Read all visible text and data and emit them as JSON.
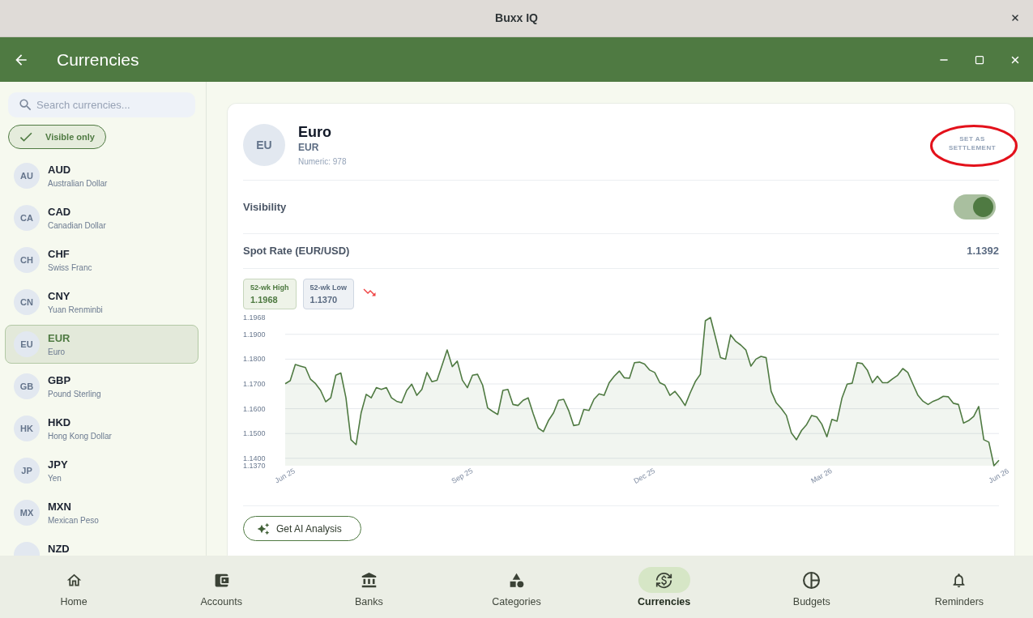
{
  "window": {
    "title": "Buxx IQ"
  },
  "app_bar": {
    "title": "Currencies"
  },
  "sidebar": {
    "search": {
      "placeholder": "Search currencies..."
    },
    "filter_chip": {
      "label": "Visible only",
      "checked": true
    },
    "currencies": [
      {
        "initials": "AU",
        "code": "AUD",
        "name": "Australian Dollar",
        "selected": false
      },
      {
        "initials": "CA",
        "code": "CAD",
        "name": "Canadian Dollar",
        "selected": false
      },
      {
        "initials": "CH",
        "code": "CHF",
        "name": "Swiss Franc",
        "selected": false
      },
      {
        "initials": "CN",
        "code": "CNY",
        "name": "Yuan Renminbi",
        "selected": false
      },
      {
        "initials": "EU",
        "code": "EUR",
        "name": "Euro",
        "selected": true
      },
      {
        "initials": "GB",
        "code": "GBP",
        "name": "Pound Sterling",
        "selected": false
      },
      {
        "initials": "HK",
        "code": "HKD",
        "name": "Hong Kong Dollar",
        "selected": false
      },
      {
        "initials": "JP",
        "code": "JPY",
        "name": "Yen",
        "selected": false
      },
      {
        "initials": "MX",
        "code": "MXN",
        "name": "Mexican Peso",
        "selected": false
      },
      {
        "code": "NZD",
        "selected": false
      }
    ]
  },
  "detail": {
    "initials": "EU",
    "name": "Euro",
    "code": "EUR",
    "numeric": "Numeric: 978",
    "settlement_button": {
      "label": "SET AS SETTLEMENT",
      "highlighted": true
    },
    "visibility": {
      "label": "Visibility",
      "on": true
    },
    "spot_rate": {
      "label": "Spot Rate (EUR/USD)",
      "value": "1.1392"
    },
    "stats": [
      {
        "kind": "high",
        "label": "52-wk High",
        "value": "1.1968"
      },
      {
        "kind": "low",
        "label": "52-wk Low",
        "value": "1.1370"
      }
    ],
    "trend": {
      "kind": "down"
    },
    "chart_data": {
      "type": "area",
      "grid": true,
      "ylim": [
        1.137,
        1.1968
      ],
      "yticks": [
        {
          "value": 1.137,
          "label": "1.1370"
        },
        {
          "value": 1.14,
          "label": "1.1400"
        },
        {
          "value": 1.15,
          "label": "1.1500"
        },
        {
          "value": 1.16,
          "label": "1.1600"
        },
        {
          "value": 1.17,
          "label": "1.1700"
        },
        {
          "value": 1.18,
          "label": "1.1800"
        },
        {
          "value": 1.19,
          "label": "1.1900"
        },
        {
          "value": 1.1968,
          "label": "1.1968"
        }
      ],
      "categories": [
        "Jun 25",
        null,
        null,
        null,
        null,
        null,
        null,
        null,
        null,
        null,
        null,
        null,
        null,
        null,
        null,
        null,
        null,
        null,
        null,
        null,
        null,
        null,
        null,
        null,
        null,
        null,
        null,
        null,
        null,
        null,
        null,
        null,
        null,
        null,
        null,
        "Sep 25",
        null,
        null,
        null,
        null,
        null,
        null,
        null,
        null,
        null,
        null,
        null,
        null,
        null,
        null,
        null,
        null,
        null,
        null,
        null,
        null,
        null,
        null,
        null,
        null,
        null,
        null,
        null,
        null,
        null,
        null,
        null,
        null,
        null,
        null,
        null,
        "Dec 25",
        null,
        null,
        null,
        null,
        null,
        null,
        null,
        null,
        null,
        null,
        null,
        null,
        null,
        null,
        null,
        null,
        null,
        null,
        null,
        null,
        null,
        null,
        null,
        null,
        null,
        null,
        null,
        null,
        null,
        null,
        null,
        null,
        null,
        null,
        "Mar 26",
        null,
        null,
        null,
        null,
        null,
        null,
        null,
        null,
        null,
        null,
        null,
        null,
        null,
        null,
        null,
        null,
        null,
        null,
        null,
        null,
        null,
        null,
        null,
        null,
        null,
        null,
        null,
        null,
        null,
        null,
        null,
        null,
        null,
        null,
        "Jun 26"
      ],
      "series": [
        {
          "color": "#4f7a42",
          "values": [
            1.1701,
            1.1713,
            1.1778,
            1.1772,
            1.1766,
            1.1719,
            1.1701,
            1.1674,
            1.1628,
            1.1644,
            1.1735,
            1.1744,
            1.1644,
            1.1475,
            1.1455,
            1.1583,
            1.1658,
            1.1644,
            1.1685,
            1.1678,
            1.1685,
            1.1644,
            1.163,
            1.1624,
            1.1674,
            1.1699,
            1.1654,
            1.1678,
            1.1746,
            1.1709,
            1.1715,
            1.1776,
            1.1837,
            1.177,
            1.1792,
            1.1715,
            1.1685,
            1.1735,
            1.1739,
            1.1695,
            1.1603,
            1.1589,
            1.1577,
            1.1674,
            1.1678,
            1.1617,
            1.1613,
            1.1634,
            1.1644,
            1.1579,
            1.1522,
            1.1508,
            1.1552,
            1.1583,
            1.1634,
            1.1638,
            1.1593,
            1.1532,
            1.1536,
            1.1597,
            1.1593,
            1.1638,
            1.166,
            1.1654,
            1.1705,
            1.1731,
            1.1752,
            1.1725,
            1.1723,
            1.1786,
            1.1788,
            1.178,
            1.1756,
            1.1746,
            1.1705,
            1.1695,
            1.1654,
            1.167,
            1.1644,
            1.1613,
            1.1664,
            1.1709,
            1.1739,
            1.1955,
            1.1968,
            1.1888,
            1.1806,
            1.18,
            1.1898,
            1.1872,
            1.1857,
            1.1837,
            1.1772,
            1.18,
            1.1811,
            1.1806,
            1.167,
            1.1624,
            1.1601,
            1.1573,
            1.1502,
            1.1475,
            1.1512,
            1.1536,
            1.1573,
            1.1567,
            1.1538,
            1.1487,
            1.1557,
            1.155,
            1.1644,
            1.1699,
            1.1703,
            1.1786,
            1.1782,
            1.1756,
            1.1705,
            1.1731,
            1.1705,
            1.1705,
            1.1721,
            1.1735,
            1.1762,
            1.1746,
            1.1699,
            1.1654,
            1.163,
            1.1617,
            1.163,
            1.1638,
            1.165,
            1.1648,
            1.1622,
            1.1617,
            1.1542,
            1.1552,
            1.1569,
            1.1609,
            1.1475,
            1.1465,
            1.137,
            1.1392
          ]
        }
      ]
    },
    "ai_button": {
      "label": "Get AI Analysis"
    }
  },
  "bottom_nav": [
    {
      "label": "Home",
      "selected": false
    },
    {
      "label": "Accounts",
      "selected": false
    },
    {
      "label": "Banks",
      "selected": false
    },
    {
      "label": "Categories",
      "selected": false
    },
    {
      "label": "Currencies",
      "selected": true
    },
    {
      "label": "Budgets",
      "selected": false
    },
    {
      "label": "Reminders",
      "selected": false
    }
  ]
}
